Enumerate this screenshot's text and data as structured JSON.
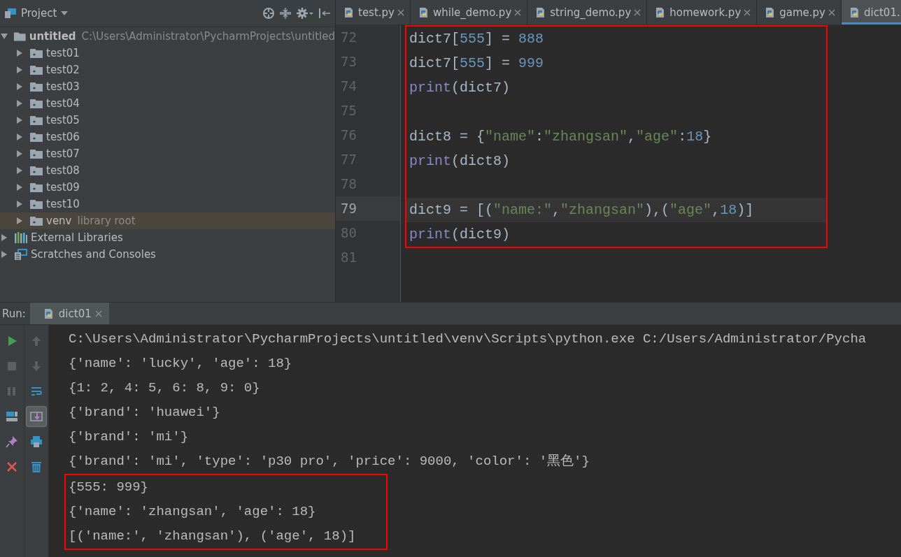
{
  "project_panel": {
    "title": "Project",
    "tree": [
      {
        "label": "untitled",
        "detail": "C:\\Users\\Administrator\\PycharmProjects\\untitled",
        "kind": "project",
        "expanded": true,
        "selected": false,
        "children": [
          {
            "label": "test01",
            "kind": "folder",
            "expanded": false,
            "selected": false
          },
          {
            "label": "test02",
            "kind": "folder",
            "expanded": false,
            "selected": false
          },
          {
            "label": "test03",
            "kind": "folder",
            "expanded": false,
            "selected": false
          },
          {
            "label": "test04",
            "kind": "folder",
            "expanded": false,
            "selected": false
          },
          {
            "label": "test05",
            "kind": "folder",
            "expanded": false,
            "selected": false
          },
          {
            "label": "test06",
            "kind": "folder",
            "expanded": false,
            "selected": false
          },
          {
            "label": "test07",
            "kind": "folder",
            "expanded": false,
            "selected": false
          },
          {
            "label": "test08",
            "kind": "folder",
            "expanded": false,
            "selected": false
          },
          {
            "label": "test09",
            "kind": "folder",
            "expanded": false,
            "selected": false
          },
          {
            "label": "test10",
            "kind": "folder",
            "expanded": false,
            "selected": false
          },
          {
            "label": "venv",
            "detail": "library root",
            "kind": "folder",
            "expanded": false,
            "selected": true
          }
        ]
      },
      {
        "label": "External Libraries",
        "kind": "libraries",
        "expanded": false,
        "selected": false
      },
      {
        "label": "Scratches and Consoles",
        "kind": "scratches",
        "expanded": false,
        "selected": false
      }
    ]
  },
  "editor": {
    "tabs": [
      {
        "label": "test.py",
        "selected": false
      },
      {
        "label": "while_demo.py",
        "selected": false
      },
      {
        "label": "string_demo.py",
        "selected": false
      },
      {
        "label": "homework.py",
        "selected": false
      },
      {
        "label": "game.py",
        "selected": false
      },
      {
        "label": "dict01.",
        "selected": true
      }
    ],
    "blocks": [
      {
        "kind": "highlighted",
        "lines": [
          {
            "number": "72",
            "current": false,
            "tokens": [
              {
                "kind": "plain",
                "text": "dict7["
              },
              {
                "kind": "number",
                "text": "555"
              },
              {
                "kind": "plain",
                "text": "] = "
              },
              {
                "kind": "number",
                "text": "888"
              }
            ]
          },
          {
            "number": "73",
            "current": false,
            "tokens": [
              {
                "kind": "plain",
                "text": "dict7["
              },
              {
                "kind": "number",
                "text": "555"
              },
              {
                "kind": "plain",
                "text": "] = "
              },
              {
                "kind": "number",
                "text": "999"
              }
            ]
          },
          {
            "number": "74",
            "current": false,
            "tokens": [
              {
                "kind": "builtin",
                "text": "print"
              },
              {
                "kind": "plain",
                "text": "(dict7)"
              }
            ]
          },
          {
            "number": "75",
            "current": false
          },
          {
            "number": "76",
            "current": false,
            "tokens": [
              {
                "kind": "plain",
                "text": "dict8 = {"
              },
              {
                "kind": "string",
                "text": "\"name\""
              },
              {
                "kind": "plain",
                "text": ":"
              },
              {
                "kind": "string",
                "text": "\"zhangsan\""
              },
              {
                "kind": "plain",
                "text": ","
              },
              {
                "kind": "string",
                "text": "\"age\""
              },
              {
                "kind": "plain",
                "text": ":"
              },
              {
                "kind": "number",
                "text": "18"
              },
              {
                "kind": "plain",
                "text": "}"
              }
            ]
          },
          {
            "number": "77",
            "current": false,
            "tokens": [
              {
                "kind": "builtin",
                "text": "print"
              },
              {
                "kind": "plain",
                "text": "(dict8)"
              }
            ]
          },
          {
            "number": "78",
            "current": false
          },
          {
            "number": "79",
            "current": true,
            "tokens": [
              {
                "kind": "plain",
                "text": "dict9 = [("
              },
              {
                "kind": "string",
                "text": "\"name:\""
              },
              {
                "kind": "plain",
                "text": ","
              },
              {
                "kind": "string",
                "text": "\"zhangsan\""
              },
              {
                "kind": "plain",
                "text": "),("
              },
              {
                "kind": "string",
                "text": "\"age\""
              },
              {
                "kind": "plain",
                "text": ","
              },
              {
                "kind": "number",
                "text": "18"
              },
              {
                "kind": "plain",
                "text": ")]"
              }
            ]
          },
          {
            "number": "80",
            "current": false,
            "tokens": [
              {
                "kind": "builtin",
                "text": "print"
              },
              {
                "kind": "plain",
                "text": "(dict9)"
              }
            ]
          }
        ]
      },
      {
        "kind": "plain",
        "lines": [
          {
            "number": "81",
            "current": false
          }
        ]
      }
    ]
  },
  "run_panel": {
    "label": "Run:",
    "tab": {
      "label": "dict01",
      "selected": true
    },
    "left_tools": [
      {
        "kind": "run",
        "on": false
      },
      {
        "kind": "stop",
        "on": false
      },
      {
        "kind": "pause",
        "on": false
      },
      {
        "kind": "layout",
        "on": false
      },
      {
        "kind": "pin",
        "on": false
      },
      {
        "kind": "close",
        "on": false
      }
    ],
    "right_tools": [
      {
        "kind": "up",
        "on": false
      },
      {
        "kind": "down",
        "on": false
      },
      {
        "kind": "wrap",
        "on": false
      },
      {
        "kind": "scroll-end",
        "on": true
      },
      {
        "kind": "print",
        "on": false
      },
      {
        "kind": "trash",
        "on": false
      }
    ],
    "output_blocks": [
      {
        "kind": "plain",
        "lines": [
          "C:\\Users\\Administrator\\PycharmProjects\\untitled\\venv\\Scripts\\python.exe C:/Users/Administrator/Pycha",
          "{'name': 'lucky', 'age': 18}",
          "{1: 2, 4: 5, 6: 8, 9: 0}",
          "{'brand': 'huawei'}",
          "{'brand': 'mi'}",
          "{'brand': 'mi', 'type': 'p30 pro', 'price': 9000, 'color': '黑色'}"
        ]
      },
      {
        "kind": "highlighted",
        "lines": [
          "{555: 999}",
          "{'name': 'zhangsan', 'age': 18}",
          "[('name:', 'zhangsan'), ('age', 18)]"
        ]
      }
    ]
  }
}
